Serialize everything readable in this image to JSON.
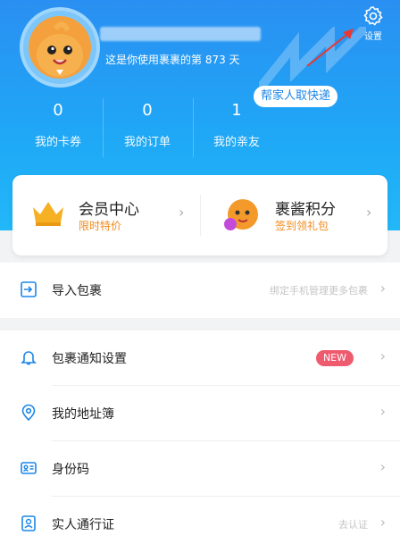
{
  "header": {
    "tagline": "这是你使用裹裹的第 873 天",
    "settings_label": "设置",
    "pickup_button": "帮家人取快递",
    "stats": [
      {
        "value": "0",
        "label": "我的卡券"
      },
      {
        "value": "0",
        "label": "我的订单"
      },
      {
        "value": "1",
        "label": "我的亲友"
      }
    ]
  },
  "cards": {
    "member": {
      "title": "会员中心",
      "subtitle": "限时特价"
    },
    "points": {
      "title": "裹酱积分",
      "subtitle": "签到领礼包"
    }
  },
  "menu": {
    "import": {
      "label": "导入包裹",
      "note": "绑定手机管理更多包裹"
    },
    "notify": {
      "label": "包裹通知设置",
      "badge": "NEW"
    },
    "address": {
      "label": "我的地址簿"
    },
    "idcode": {
      "label": "身份码"
    },
    "realname": {
      "label": "实人通行证",
      "note": "去认证"
    }
  },
  "icons": {
    "settings": "gear-icon",
    "member": "crown-icon",
    "points": "mascot-icon",
    "import": "import-icon",
    "notify": "bell-icon",
    "address": "location-pin-icon",
    "idcode": "id-card-icon",
    "realname": "person-badge-icon",
    "chevron": "chevron-right-icon"
  },
  "colors": {
    "header_blue": "#2a8ff2",
    "accent_orange": "#f08a1c",
    "badge_red": "#ef5b6e",
    "icon_blue": "#1b86e8"
  }
}
